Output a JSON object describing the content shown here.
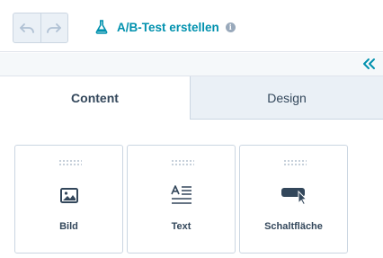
{
  "toolbar": {
    "undo_icon": "undo-icon",
    "redo_icon": "redo-icon",
    "abtest_label": "A/B-Test erstellen",
    "abtest_icon": "flask-icon",
    "info_icon": "info-icon"
  },
  "panel": {
    "collapse_icon": "double-chevron-left-icon"
  },
  "tabs": [
    {
      "label": "Content",
      "active": true
    },
    {
      "label": "Design",
      "active": false
    }
  ],
  "modules": [
    {
      "label": "Bild",
      "icon": "image-icon"
    },
    {
      "label": "Text",
      "icon": "text-icon"
    },
    {
      "label": "Schaltfläche",
      "icon": "button-icon"
    }
  ],
  "colors": {
    "accent": "#0091ae",
    "text": "#33475b",
    "border": "#cbd6e2",
    "inactive_tab": "#eaf0f6"
  }
}
